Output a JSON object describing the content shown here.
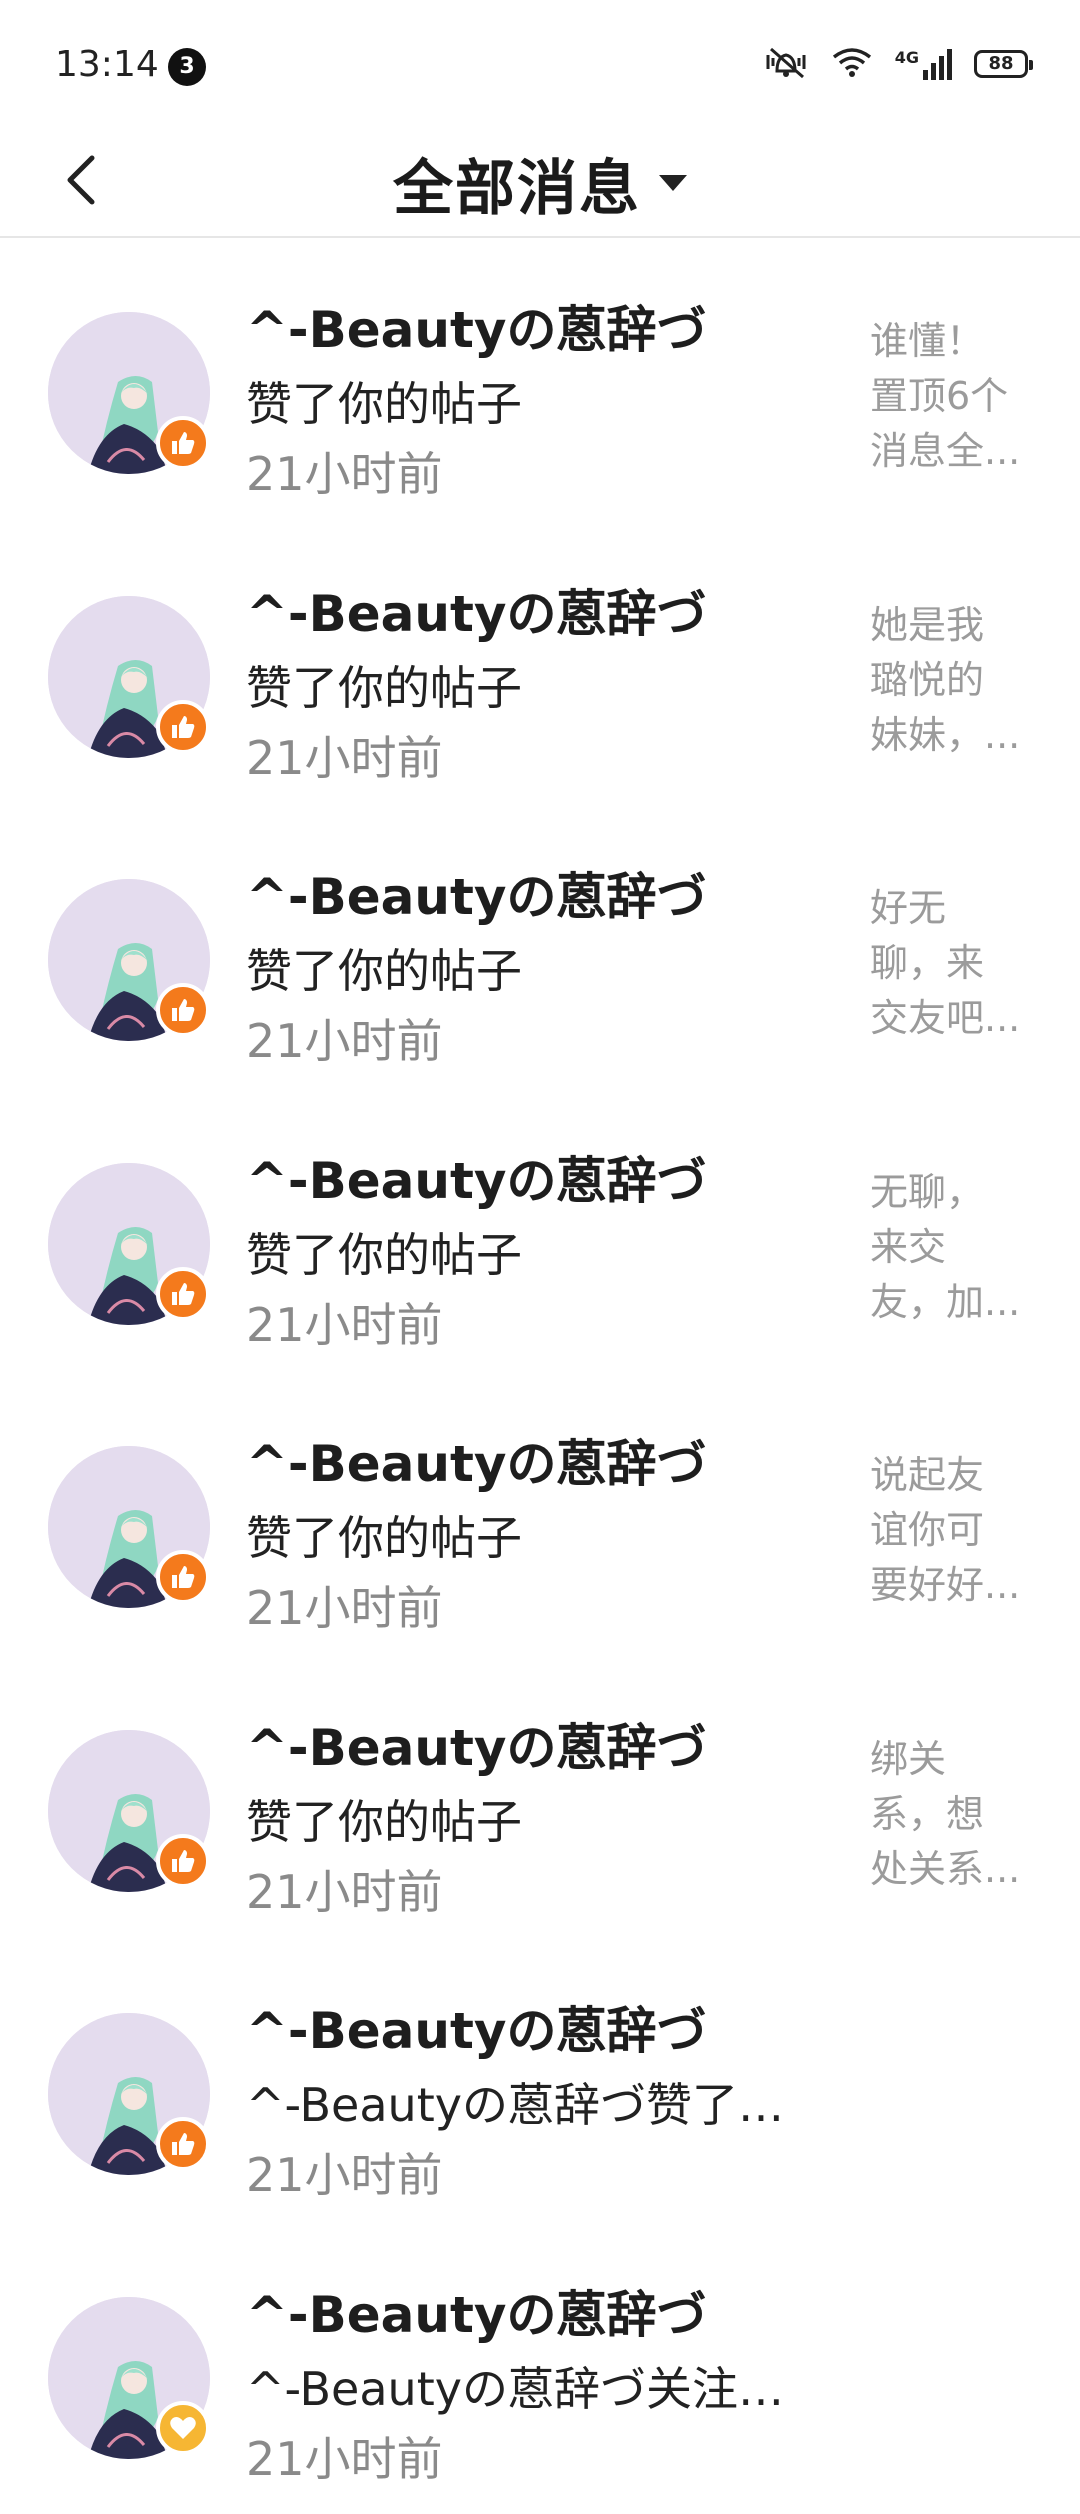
{
  "status_bar": {
    "time": "13:14",
    "notification_count": "3",
    "network": "4G",
    "battery": "88"
  },
  "header": {
    "title": "全部消息"
  },
  "colors": {
    "like_badge": "#f47a1c",
    "follow_badge": "#f6b633",
    "avatar_bg": "#e4dcee"
  },
  "messages": [
    {
      "name": "^-Beautyの蒽辞づ",
      "action": "赞了你的帖子",
      "time": "21小时前",
      "badge_icon": "thumbs-up-icon",
      "preview": [
        "谁懂！",
        "置顶6个",
        "消息全..."
      ]
    },
    {
      "name": "^-Beautyの蒽辞づ",
      "action": "赞了你的帖子",
      "time": "21小时前",
      "badge_icon": "thumbs-up-icon",
      "preview": [
        "她是我",
        "璐悦的",
        "妹妹，..."
      ]
    },
    {
      "name": "^-Beautyの蒽辞づ",
      "action": "赞了你的帖子",
      "time": "21小时前",
      "badge_icon": "thumbs-up-icon",
      "preview": [
        "好无",
        "聊，来",
        "交友吧..."
      ]
    },
    {
      "name": "^-Beautyの蒽辞づ",
      "action": "赞了你的帖子",
      "time": "21小时前",
      "badge_icon": "thumbs-up-icon",
      "preview": [
        "无聊，",
        "来交",
        "友，加..."
      ]
    },
    {
      "name": "^-Beautyの蒽辞づ",
      "action": "赞了你的帖子",
      "time": "21小时前",
      "badge_icon": "thumbs-up-icon",
      "preview": [
        "说起友",
        "谊你可",
        "要好好..."
      ]
    },
    {
      "name": "^-Beautyの蒽辞づ",
      "action": "赞了你的帖子",
      "time": "21小时前",
      "badge_icon": "thumbs-up-icon",
      "preview": [
        "绑关",
        "系，想",
        "处关系..."
      ]
    },
    {
      "name": "^-Beautyの蒽辞づ",
      "action": "^-Beautyの蒽辞づ赞了你...",
      "time": "21小时前",
      "badge_icon": "thumbs-up-icon",
      "preview": [
        "",
        "",
        ""
      ]
    },
    {
      "name": "^-Beautyの蒽辞づ",
      "action": "^-Beautyの蒽辞づ关注了你",
      "time": "21小时前",
      "badge_icon": "heart-icon",
      "preview": [
        "",
        "",
        ""
      ]
    }
  ]
}
